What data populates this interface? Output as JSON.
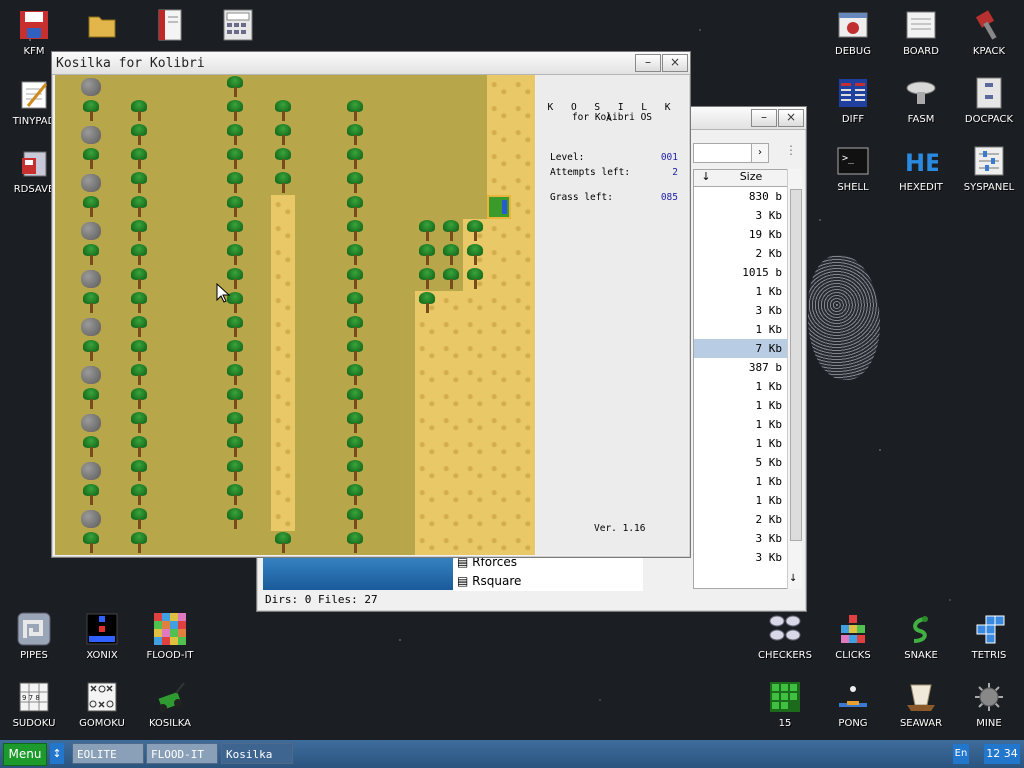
{
  "desktop": {
    "icons_top_left": [
      {
        "label": "KFM",
        "icon": "floppy-disk-icon"
      },
      {
        "label": "",
        "icon": "folder-icon"
      },
      {
        "label": "",
        "icon": "book-icon"
      },
      {
        "label": "",
        "icon": "calculator-icon"
      },
      {
        "label": "TINYPAD",
        "icon": "notepad-icon"
      },
      {
        "label": "RDSAVE",
        "icon": "save-disk-icon"
      }
    ],
    "icons_top_right": [
      {
        "label": "DEBUG",
        "icon": "debug-icon"
      },
      {
        "label": "BOARD",
        "icon": "board-icon"
      },
      {
        "label": "KPACK",
        "icon": "kpack-icon"
      },
      {
        "label": "DIFF",
        "icon": "diff-icon"
      },
      {
        "label": "FASM",
        "icon": "fasm-icon"
      },
      {
        "label": "DOCPACK",
        "icon": "docpack-icon"
      },
      {
        "label": "SHELL",
        "icon": "shell-icon"
      },
      {
        "label": "HEXEDIT",
        "icon": "hexedit-icon"
      },
      {
        "label": "SYSPANEL",
        "icon": "syspanel-icon"
      }
    ],
    "icons_bottom_left": [
      {
        "label": "PIPES",
        "icon": "pipes-icon"
      },
      {
        "label": "XONIX",
        "icon": "xonix-icon"
      },
      {
        "label": "FLOOD-IT",
        "icon": "flood-it-icon"
      },
      {
        "label": "SUDOKU",
        "icon": "sudoku-icon"
      },
      {
        "label": "GOMOKU",
        "icon": "gomoku-icon"
      },
      {
        "label": "KOSILKA",
        "icon": "lawnmower-icon"
      }
    ],
    "icons_bottom_right": [
      {
        "label": "CHECKERS",
        "icon": "checkers-icon"
      },
      {
        "label": "CLICKS",
        "icon": "clicks-icon"
      },
      {
        "label": "SNAKE",
        "icon": "snake-icon"
      },
      {
        "label": "TETRIS",
        "icon": "tetris-icon"
      },
      {
        "label": "15",
        "icon": "fifteen-icon"
      },
      {
        "label": "PONG",
        "icon": "pong-icon"
      },
      {
        "label": "SEAWAR",
        "icon": "seawar-icon"
      },
      {
        "label": "MINE",
        "icon": "mine-icon"
      }
    ]
  },
  "file_manager": {
    "column_size": "Size",
    "sizes": [
      "830 b",
      "3 Kb",
      "19 Kb",
      "2 Kb",
      "1015 b",
      "1 Kb",
      "3 Kb",
      "1 Kb",
      "7 Kb",
      "387 b",
      "1 Kb",
      "1 Kb",
      "1 Kb",
      "1 Kb",
      "5 Kb",
      "1 Kb",
      "1 Kb",
      "2 Kb",
      "3 Kb",
      "3 Kb"
    ],
    "selected_index": 8,
    "visible_files": [
      "Rforces",
      "Rsquare"
    ],
    "status": "Dirs: 0   Files: 27"
  },
  "kosilka": {
    "title": "Kosilka for Kolibri",
    "header": "K O S I L K A",
    "subheader": "for Kolibri OS",
    "level_label": "Level:",
    "level_value": "001",
    "attempts_label": "Attempts left:",
    "attempts_value": "2",
    "grass_label": "Grass left:",
    "grass_value": "085",
    "version": "Ver. 1.16"
  },
  "taskbar": {
    "menu_label": "Menu",
    "arrow": "↕",
    "tasks": [
      "EOLITE",
      "FLOOD-IT",
      "Kosilka"
    ],
    "active_task": 2,
    "lang": "En",
    "clock": "12 34"
  },
  "colors": {
    "grass": "#b8a64a",
    "sand": "#e8c867",
    "taskbar": "#2b557f",
    "menu_button": "#1c9a2c"
  }
}
